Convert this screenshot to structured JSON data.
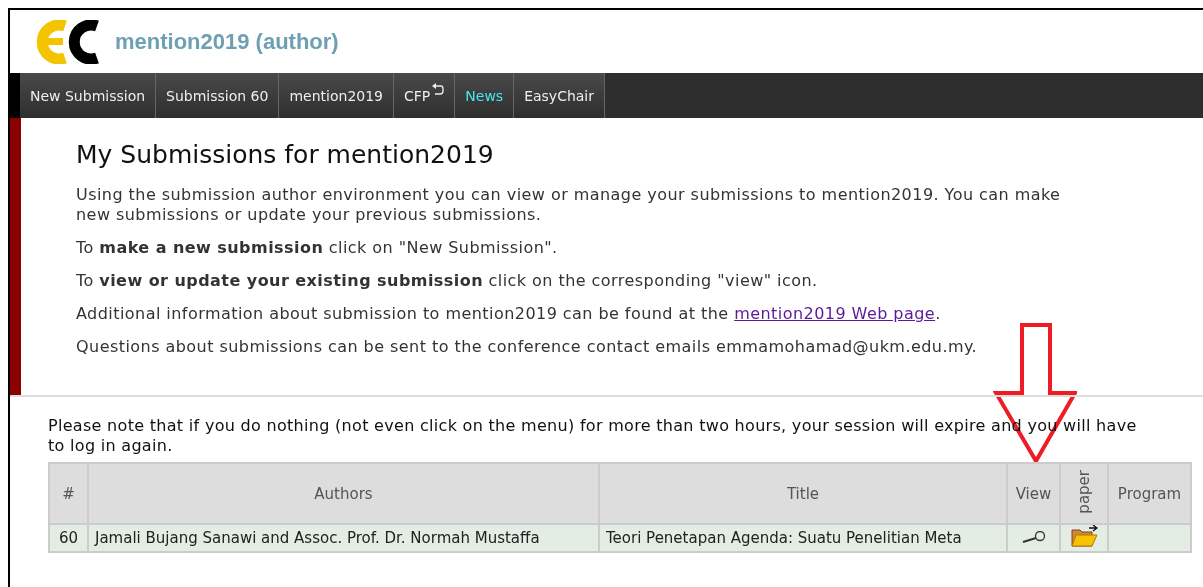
{
  "header": {
    "title": "mention2019 (author)"
  },
  "nav": [
    {
      "label": "New Submission",
      "selected": false,
      "kind": "plain"
    },
    {
      "label": "Submission 60",
      "selected": false,
      "kind": "plain"
    },
    {
      "label": "mention2019",
      "selected": false,
      "kind": "plain"
    },
    {
      "label": "CFP",
      "selected": false,
      "kind": "return"
    },
    {
      "label": "News",
      "selected": true,
      "kind": "plain"
    },
    {
      "label": "EasyChair",
      "selected": false,
      "kind": "plain"
    }
  ],
  "intro": {
    "heading": "My Submissions for mention2019",
    "paragraphs": [
      {
        "text": "Using the submission author environment you can view or manage your submissions to mention2019. You can make new submissions or update your previous submissions."
      },
      {
        "text": "To **make a new submission** click on \"New Submission\"."
      },
      {
        "text": "To **view or update your existing submission** click on the corresponding \"view\" icon."
      },
      {
        "text": "Additional information about submission to mention2019 can be found at the ",
        "link": "mention2019 Web page",
        "after": "."
      },
      {
        "text": "Questions about submissions can be sent to the conference contact emails emmamohamad@ukm.edu.my."
      }
    ]
  },
  "notice": "Please note that if you do nothing (not even click on the menu) for more than two hours, your session will expire and you will have to log in again.",
  "table": {
    "columns": [
      {
        "label": "#",
        "kind": "plain"
      },
      {
        "label": "Authors",
        "kind": "plain"
      },
      {
        "label": "Title",
        "kind": "plain"
      },
      {
        "label": "View",
        "kind": "plain"
      },
      {
        "label": "paper",
        "kind": "vertical"
      },
      {
        "label": "Program",
        "kind": "plain"
      }
    ],
    "rows": [
      {
        "number": "60",
        "authors": "Jamali Bujang Sanawi and Assoc. Prof. Dr. Normah Mustaffa",
        "title": "Teori Penetapan Agenda: Suatu Penelitian Meta"
      }
    ]
  }
}
